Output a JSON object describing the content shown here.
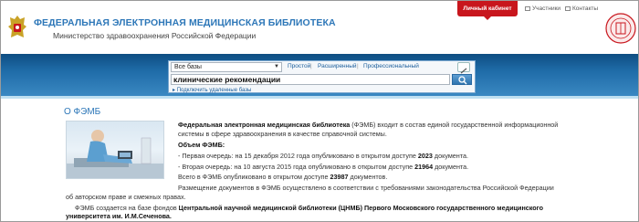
{
  "header": {
    "title": "ФЕДЕРАЛЬНАЯ ЭЛЕКТРОННАЯ МЕДИЦИНСКАЯ БИБЛИОТЕКА",
    "subtitle": "Министерство здравоохранения Российской Федерации",
    "cabinet_label": "Личный кабинет",
    "links": [
      "Участники",
      "Контакты"
    ]
  },
  "search": {
    "db_selected": "Все базы",
    "modes": [
      "Простой",
      "Расширенный",
      "Профессиональный"
    ],
    "query": "клинические рекомендации",
    "connect_link": "Подключить удаленные базы"
  },
  "content": {
    "section_title": "О ФЭМБ",
    "p1_bold": "Федеральная электронная медицинская библиотека",
    "p1_rest": " (ФЭМБ) входит в состав единой государственной информационной",
    "p1_line2": "системы в сфере здравоохранения в качестве справочной системы.",
    "volume_label": "Объем ФЭМБ:",
    "line_q1_pre": "- Первая очередь: на 15 декабря 2012 года опубликовано в открытом доступе ",
    "line_q1_num": "2023",
    "line_q1_post": " документа.",
    "line_q2_pre": "- Вторая очередь: на 10 августа 2015 года опубликовано в открытом доступе ",
    "line_q2_num": "21964",
    "line_q2_post": " документа.",
    "total_pre": "Всего в ФЭМБ опубликовано в открытом доступе ",
    "total_num": "23987",
    "total_post": " документов.",
    "p3_line1": "Размещение документов в ФЭМБ осуществлено в соответствии с требованиями законодательства Российской Федерации",
    "p3_line2": "об авторском праве и смежных правах.",
    "p4_pre": "ФЭМБ создается на базе фондов ",
    "p4_bold1": "Центральной научной медицинской библиотеки (ЦНМБ) Первого Московского государственного медицинского",
    "p4_bold2": "университета им. И.М.Сеченова."
  },
  "colors": {
    "brand_blue": "#2d77b8",
    "band_dark": "#0e4d82",
    "cabinet_red": "#c8161d"
  }
}
